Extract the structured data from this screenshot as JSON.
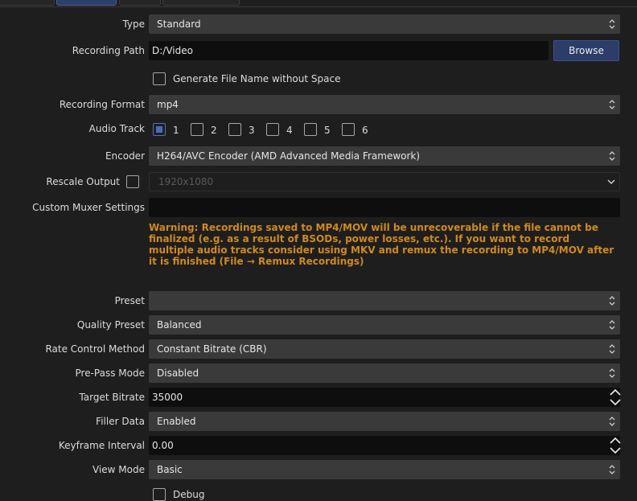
{
  "fields": {
    "type": {
      "label": "Type",
      "value": "Standard"
    },
    "recording_path": {
      "label": "Recording Path",
      "value": "D:/Video",
      "browse": "Browse"
    },
    "gen_filename": {
      "label": "Generate File Name without Space",
      "checked": false
    },
    "recording_format": {
      "label": "Recording Format",
      "value": "mp4"
    },
    "audio_track": {
      "label": "Audio Track",
      "tracks": [
        {
          "label": "1",
          "checked": true
        },
        {
          "label": "2",
          "checked": false
        },
        {
          "label": "3",
          "checked": false
        },
        {
          "label": "4",
          "checked": false
        },
        {
          "label": "5",
          "checked": false
        },
        {
          "label": "6",
          "checked": false
        }
      ]
    },
    "encoder": {
      "label": "Encoder",
      "value": "H264/AVC Encoder (AMD Advanced Media Framework)"
    },
    "rescale_output": {
      "label": "Rescale Output",
      "checked": false,
      "value": "1920x1080"
    },
    "custom_muxer": {
      "label": "Custom Muxer Settings",
      "value": ""
    },
    "warning": "Warning: Recordings saved to MP4/MOV will be unrecoverable if the file cannot be finalized (e.g. as a result of BSODs, power losses, etc.). If you want to record multiple audio tracks consider using MKV and remux the recording to MP4/MOV after it is finished (File → Remux Recordings)",
    "preset": {
      "label": "Preset",
      "value": ""
    },
    "quality_preset": {
      "label": "Quality Preset",
      "value": "Balanced"
    },
    "rate_control": {
      "label": "Rate Control Method",
      "value": "Constant Bitrate (CBR)"
    },
    "prepass": {
      "label": "Pre-Pass Mode",
      "value": "Disabled"
    },
    "target_bitrate": {
      "label": "Target Bitrate",
      "value": "35000"
    },
    "filler_data": {
      "label": "Filler Data",
      "value": "Enabled"
    },
    "keyframe_interval": {
      "label": "Keyframe Interval",
      "value": "0.00"
    },
    "view_mode": {
      "label": "View Mode",
      "value": "Basic"
    },
    "debug": {
      "label": "Debug",
      "checked": false
    }
  },
  "colors": {
    "accent": "#2b3d68",
    "warning": "#cf8a1e",
    "background": "#1f1e1f"
  }
}
